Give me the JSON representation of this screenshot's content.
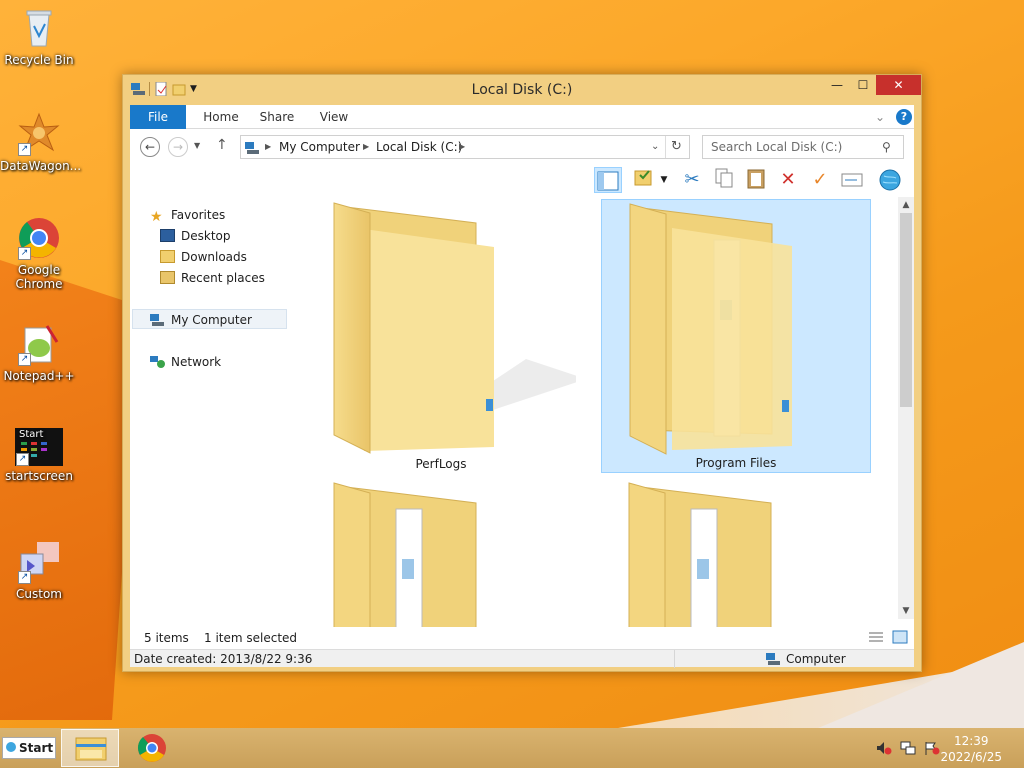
{
  "desktop": {
    "icons": [
      {
        "label": "Recycle Bin",
        "icon": "recycle-bin-icon"
      },
      {
        "label": "DataWagon...",
        "icon": "datawagon-icon"
      },
      {
        "label": "Google Chrome",
        "icon": "chrome-icon"
      },
      {
        "label": "Notepad++",
        "icon": "notepad-plus-plus-icon"
      },
      {
        "label": "startscreen",
        "icon": "startscreen-icon",
        "tile_text": "Start"
      },
      {
        "label": "Custom",
        "icon": "custom-icon"
      }
    ]
  },
  "window": {
    "title": "Local Disk (C:)",
    "ribbon_tabs": [
      "File",
      "Home",
      "Share",
      "View"
    ],
    "address": {
      "parts": [
        "My Computer",
        "Local Disk (C:)"
      ]
    },
    "search_placeholder": "Search Local Disk (C:)",
    "nav": {
      "favorites_label": "Favorites",
      "favorites": [
        "Desktop",
        "Downloads",
        "Recent places"
      ],
      "my_computer": "My Computer",
      "network": "Network"
    },
    "items": [
      {
        "name": "PerfLogs",
        "selected": false
      },
      {
        "name": "Program Files",
        "selected": true
      },
      {
        "name": "",
        "selected": false
      },
      {
        "name": "",
        "selected": false
      }
    ],
    "status": {
      "count": "5 items",
      "selection": "1 item selected"
    },
    "details": {
      "date_created": "Date created: 2013/8/22 9:36",
      "location": "Computer"
    }
  },
  "taskbar": {
    "start_label": "Start",
    "time": "12:39",
    "date": "2022/6/25"
  },
  "colors": {
    "accent": "#1979ca",
    "selection": "#cce8ff",
    "close": "#c7302c",
    "window_frame": "#f2cf82"
  }
}
